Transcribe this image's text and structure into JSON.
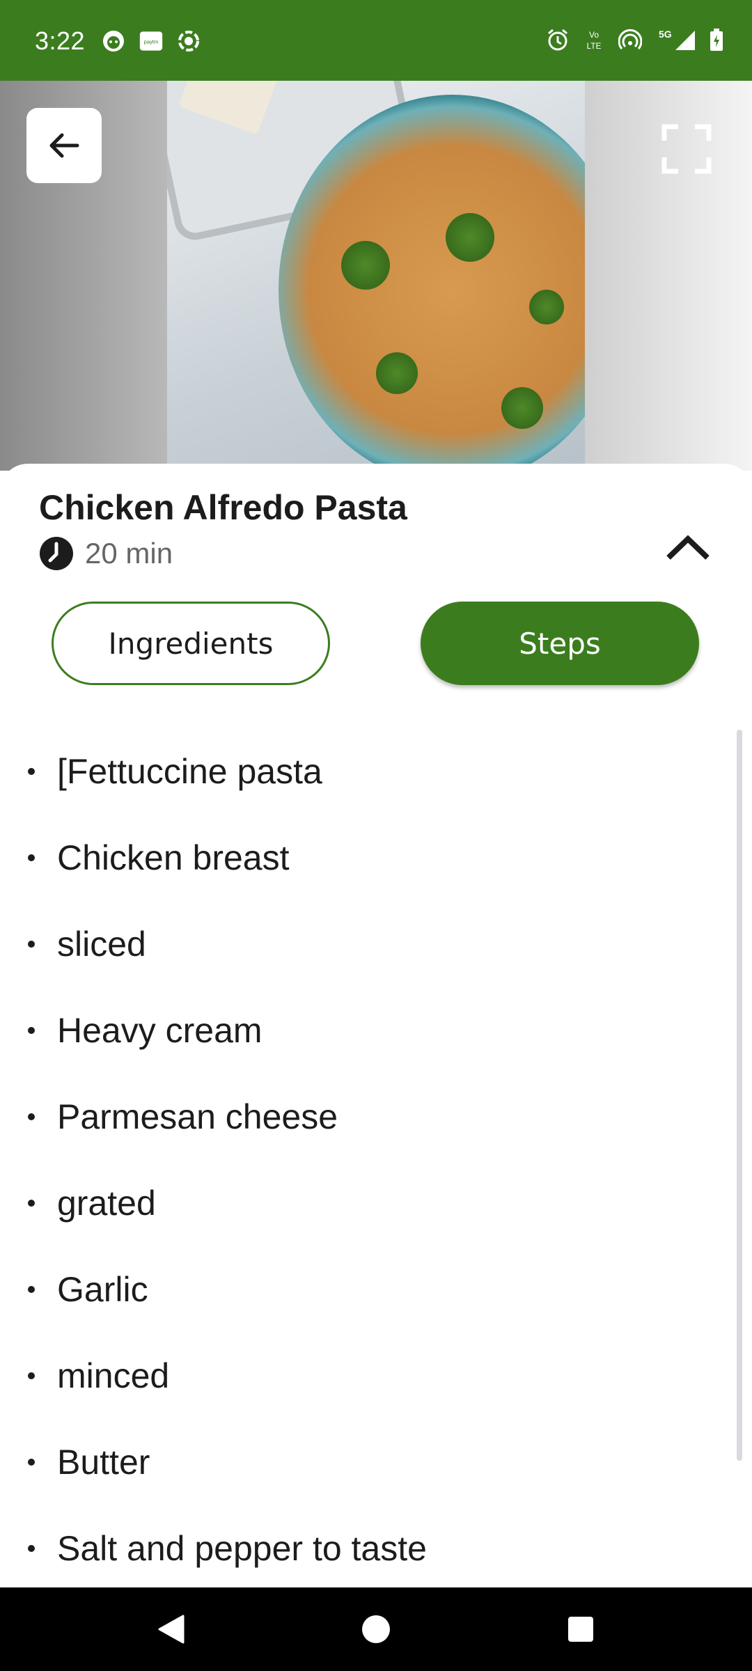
{
  "status_bar": {
    "time": "3:22",
    "left_icons": [
      "app-notification-icon",
      "paytm-icon",
      "screen-record-icon"
    ],
    "right_icons": [
      "alarm-icon",
      "volte-icon",
      "hotspot-icon",
      "5g-icon",
      "signal-icon",
      "battery-charging-icon"
    ],
    "network_label": "5G",
    "volte_label": "Vo LTE",
    "paytm_label": "paytm",
    "background_color": "#3b7d1e"
  },
  "header": {
    "back_icon": "arrow-left-icon",
    "fullscreen_icon": "fullscreen-icon"
  },
  "recipe": {
    "title": "Chicken Alfredo Pasta",
    "time_icon": "clock-icon",
    "time": "20 min",
    "collapse_icon": "chevron-up-icon"
  },
  "tabs": {
    "ingredients_label": "Ingredients",
    "steps_label": "Steps",
    "active": "Steps",
    "accent_color": "#3b7d1e"
  },
  "ingredients": [
    "[Fettuccine pasta",
    "Chicken breast",
    "sliced",
    "Heavy cream",
    "Parmesan cheese",
    "grated",
    "Garlic",
    "minced",
    "Butter",
    "Salt and pepper to taste"
  ],
  "nav_bar": {
    "back_icon": "nav-back-triangle-icon",
    "home_icon": "nav-home-circle-icon",
    "recents_icon": "nav-recents-square-icon"
  }
}
